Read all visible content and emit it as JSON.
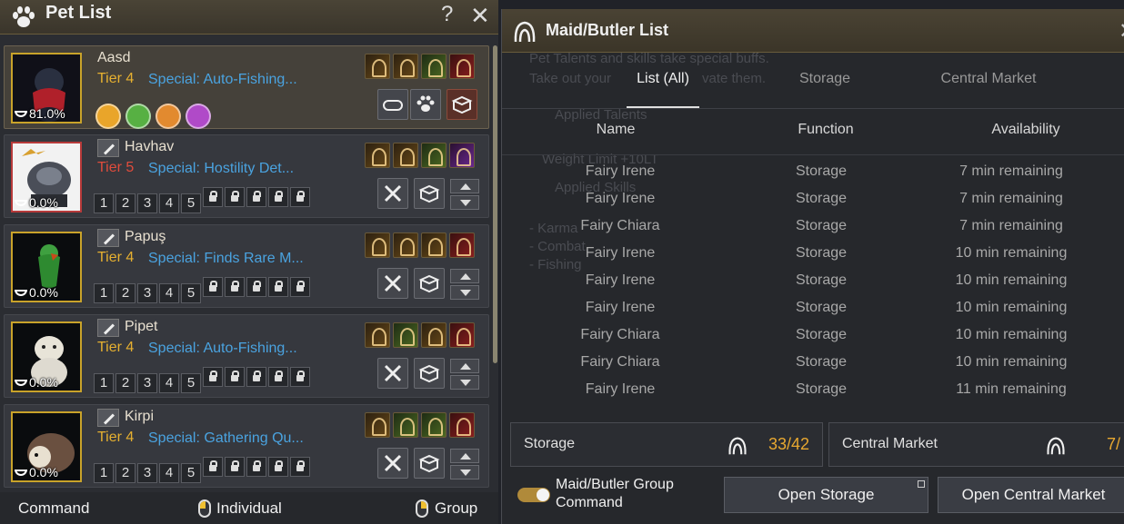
{
  "pet_panel": {
    "title": "Pet List",
    "help": "?",
    "close": "✕",
    "pets": [
      {
        "name": "Aasd",
        "tier_label": "Tier",
        "tier": "4",
        "special": "Special: Auto-Fishing...",
        "hunger": "81.0%",
        "selected": true
      },
      {
        "name": "Havhav",
        "tier_label": "Tier",
        "tier": "5",
        "special": "Special: Hostility Det...",
        "hunger": "0.0%"
      },
      {
        "name": "Papuş",
        "tier_label": "Tier",
        "tier": "4",
        "special": "Special: Finds Rare M...",
        "hunger": "0.0%"
      },
      {
        "name": "Pipet",
        "tier_label": "Tier",
        "tier": "4",
        "special": "Special: Auto-Fishing...",
        "hunger": "0.0%"
      },
      {
        "name": "Kirpi",
        "tier_label": "Tier",
        "tier": "4",
        "special": "Special: Gathering Qu...",
        "hunger": "0.0%"
      }
    ],
    "slot_numbers": [
      "1",
      "2",
      "3",
      "4",
      "5"
    ],
    "footer": {
      "command": "Command",
      "individual": "Individual",
      "group": "Group"
    }
  },
  "maid_panel": {
    "title": "Maid/Butler List",
    "close": "✕",
    "tabs": [
      "List (All)",
      "Storage",
      "Central Market"
    ],
    "columns": [
      "Name",
      "Function",
      "Availability"
    ],
    "rows": [
      {
        "name": "Fairy Irene",
        "function": "Storage",
        "availability": "7 min remaining"
      },
      {
        "name": "Fairy Irene",
        "function": "Storage",
        "availability": "7 min remaining"
      },
      {
        "name": "Fairy Chiara",
        "function": "Storage",
        "availability": "7 min remaining"
      },
      {
        "name": "Fairy Irene",
        "function": "Storage",
        "availability": "10 min remaining"
      },
      {
        "name": "Fairy Irene",
        "function": "Storage",
        "availability": "10 min remaining"
      },
      {
        "name": "Fairy Irene",
        "function": "Storage",
        "availability": "10 min remaining"
      },
      {
        "name": "Fairy Chiara",
        "function": "Storage",
        "availability": "10 min remaining"
      },
      {
        "name": "Fairy Chiara",
        "function": "Storage",
        "availability": "10 min remaining"
      },
      {
        "name": "Fairy Irene",
        "function": "Storage",
        "availability": "11 min remaining"
      }
    ],
    "storage": {
      "label": "Storage",
      "value": "33/42"
    },
    "market": {
      "label": "Central Market",
      "value": "7/"
    },
    "group_command": "Maid/Butler Group Command",
    "open_storage": "Open Storage",
    "open_market": "Open Central Market",
    "bg_text": {
      "line1": "Pet Talents and skills take special buffs.",
      "line2": "Take out your",
      "line2b": "vate them.",
      "applied_talents": "Applied Talents",
      "applied_skills": "Applied Skills",
      "weight": "Weight Limit +10LT",
      "karma": "- Karma",
      "combat": "- Combat",
      "fishing": "- Fishing"
    }
  },
  "colors": {
    "accent": "#e6b030",
    "link": "#4aa3e0",
    "tier_red": "#e04c3c",
    "amber": "#e8a830"
  }
}
